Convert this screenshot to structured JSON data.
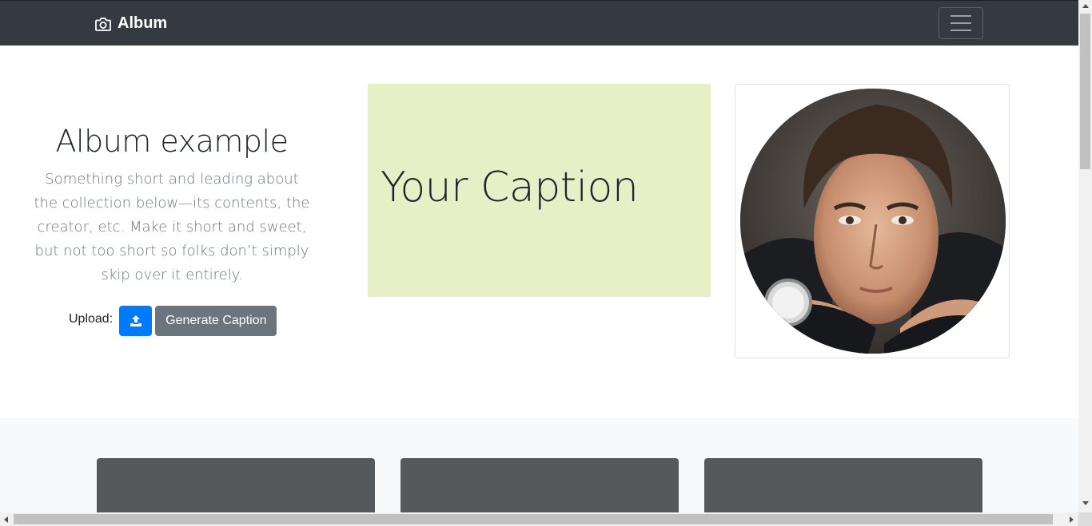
{
  "navbar": {
    "brand_label": "Album",
    "brand_icon": "camera-icon",
    "toggler_icon": "hamburger-menu-icon"
  },
  "hero": {
    "title": "Album example",
    "lead": "Something short and leading about the collection below—its contents, the creator, etc. Make it short and sweet, but not too short so folks don’t simply skip over it entirely.",
    "upload_label": "Upload:",
    "upload_icon": "upload-icon",
    "generate_button_label": "Generate Caption"
  },
  "caption": {
    "text": "Your Caption",
    "background": "#e6efc6"
  },
  "photo": {
    "subject": "portrait-photo"
  },
  "colors": {
    "navbar": "#343a40",
    "primary": "#007bff",
    "secondary": "#6c757d",
    "album_bg": "#f8f9fa",
    "card_thumb": "#55595c"
  }
}
